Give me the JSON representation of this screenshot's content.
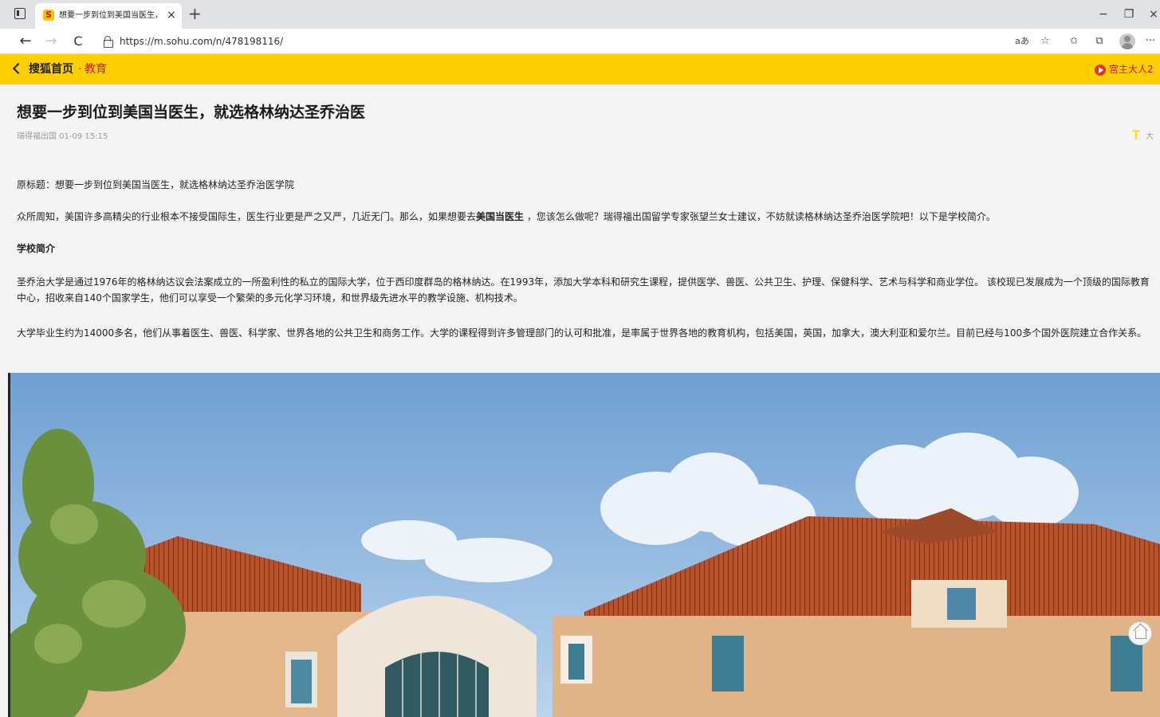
{
  "browser": {
    "tab_title": "想要一步到位到美国当医生，就选",
    "url": "https://m.sohu.com/n/478198116/",
    "tab_close_glyph": "×",
    "new_tab_glyph": "+",
    "minimize_glyph": "−",
    "restore_glyph": "❐",
    "close_glyph": "×",
    "back_glyph": "←",
    "forward_glyph": "→",
    "reload_glyph": "C",
    "read_aloud_glyph": "aあ",
    "favorite_add_glyph": "☆",
    "favorites_glyph": "✩",
    "collections_glyph": "⧉",
    "menu_glyph": "···",
    "favicon_glyph": "S"
  },
  "header": {
    "site_name": "搜狐首页",
    "separator": "·",
    "channel": "教育",
    "author": "宫主大人2"
  },
  "article": {
    "title": "想要一步到位到美国当医生，就选格林纳达圣乔治医",
    "meta": "瑞得福出国  01-09 15:15",
    "font_toggle_letter": "T",
    "font_toggle_label": "大",
    "original_title": "原标题：想要一步到位到美国当医生，就选格林纳达圣乔治医学院",
    "p1_a": "众所周知，美国许多高精尖的行业根本不接受国际生，医生行业更是严之又严，几近无门。那么，如果想要去",
    "p1_bold": "美国当医生",
    "p1_b": " ，您该怎么做呢？瑞得福出国留学专家张望兰女士建议，不妨就读格林纳达圣乔治医学院吧！以下是学校简介。",
    "section_heading": "学校简介",
    "p2": "圣乔治大学是通过1976年的格林纳达议会法案成立的一所盈利性的私立的国际大学，位于西印度群岛的格林纳达。在1993年，添加大学本科和研究生课程，提供医学、兽医、公共卫生、护理、保健科学、艺术与科学和商业学位。 该校现已发展成为一个顶级的国际教育中心，招收来自140个国家学生，他们可以享受一个繁荣的多元化学习环境，和世界级先进水平的教学设施、机构技术。",
    "p3": "大学毕业生约为14000多名，他们从事着医生、兽医、科学家、世界各地的公共卫生和商务工作。大学的课程得到许多管理部门的认可和批准，是率属于世界各地的教育机构，包括美国，英国，加拿大，澳大利亚和爱尔兰。目前已经与100多个国外医院建立合作关系。"
  },
  "colors": {
    "brand_yellow": "#ffd000",
    "brand_red": "#c8102e",
    "page_bg": "#f4f4f4"
  },
  "icons": [
    "tab-actions-icon",
    "sohu-favicon",
    "close-icon",
    "plus-icon",
    "back-arrow-icon",
    "forward-arrow-icon",
    "reload-icon",
    "lock-icon",
    "read-aloud-icon",
    "favorite-add-icon",
    "favorites-icon",
    "collections-icon",
    "profile-icon",
    "more-icon",
    "chevron-left-icon",
    "author-play-icon",
    "home-icon"
  ]
}
